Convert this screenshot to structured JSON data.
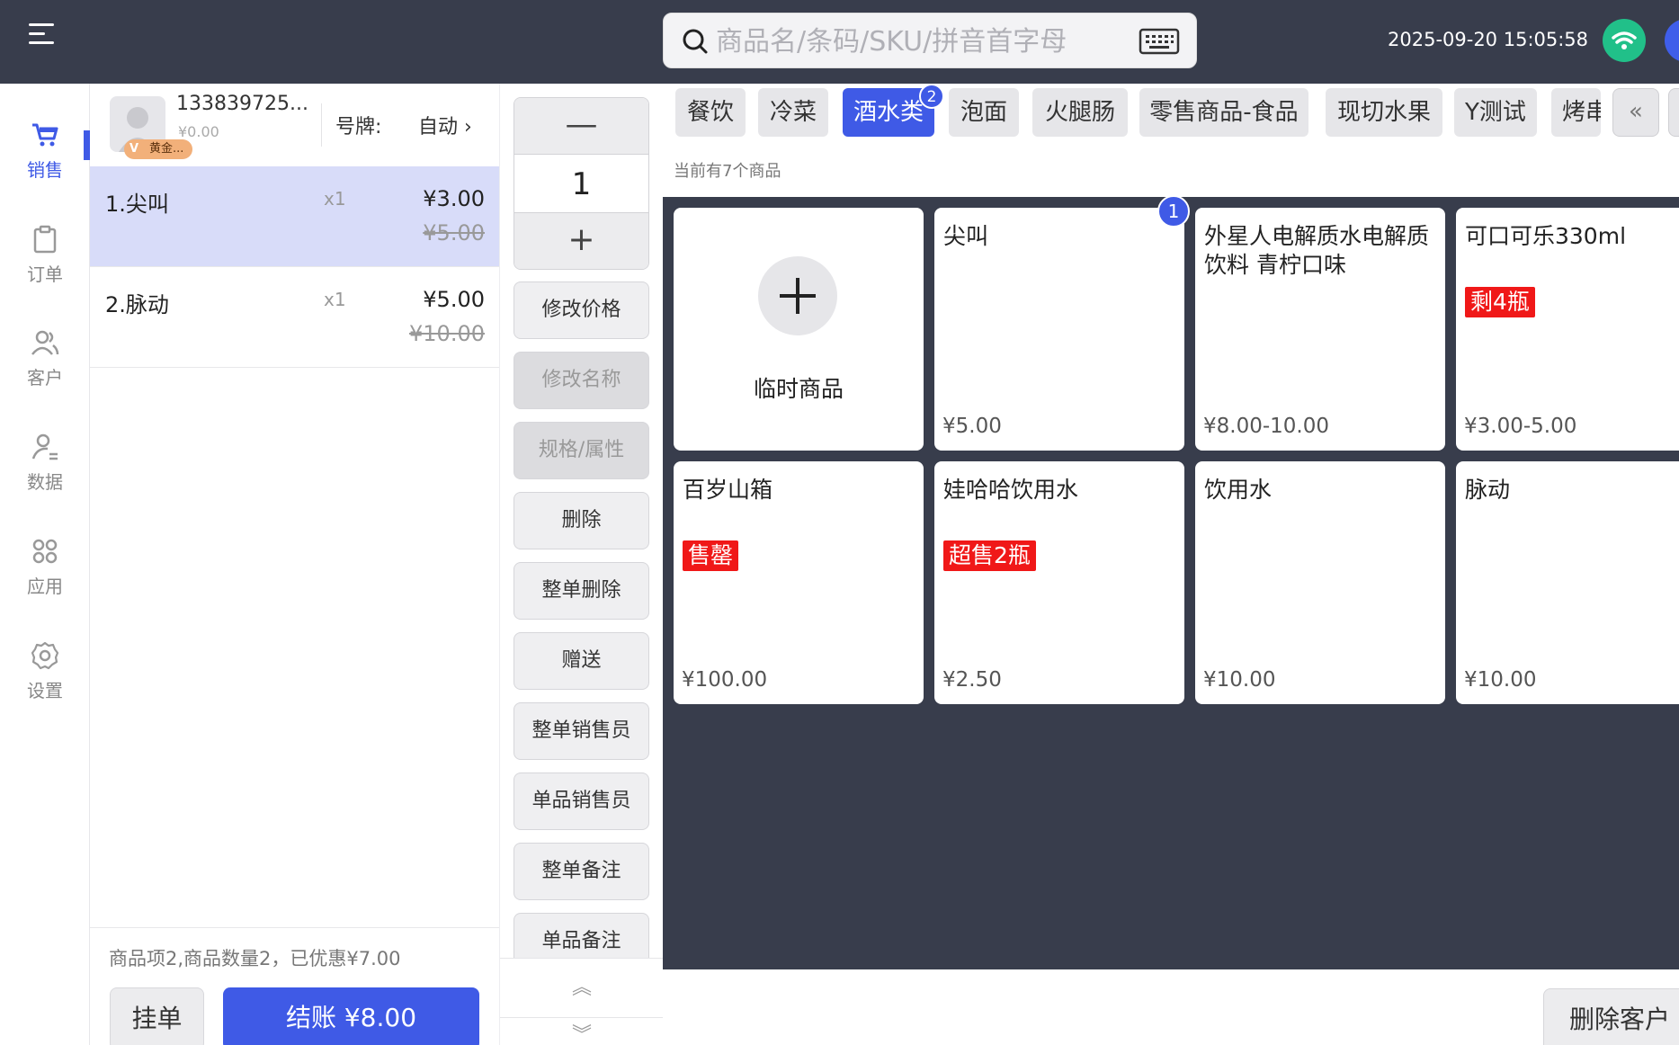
{
  "topbar": {
    "search_placeholder": "商品名/条码/SKU/拼音首字母",
    "datetime": "2025-09-20 15:05:58"
  },
  "nav": [
    {
      "label": "销售",
      "icon": "cart-icon",
      "active": true
    },
    {
      "label": "订单",
      "icon": "clipboard-icon"
    },
    {
      "label": "客户",
      "icon": "users-icon"
    },
    {
      "label": "数据",
      "icon": "user-data-icon"
    },
    {
      "label": "应用",
      "icon": "apps-icon"
    },
    {
      "label": "设置",
      "icon": "gear-icon"
    }
  ],
  "customer": {
    "id": "133839725...",
    "balance": "¥0.00",
    "vip": "黄金...",
    "plate_label": "号牌:",
    "plate_value": "自动 ›"
  },
  "order_items": [
    {
      "name": "1.尖叫",
      "qty": "x1",
      "price": "¥3.00",
      "orig": "¥5.00"
    },
    {
      "name": "2.脉动",
      "qty": "x1",
      "price": "¥5.00",
      "orig": "¥10.00"
    }
  ],
  "summary": {
    "text": "商品项2,商品数量2，已优惠¥7.00",
    "hold": "挂单",
    "pay": "结账 ¥8.00"
  },
  "actions": {
    "minus": "—",
    "qty": "1",
    "plus": "+",
    "buttons": [
      "修改价格",
      "修改名称",
      "规格/属性",
      "删除",
      "整单删除",
      "赠送",
      "整单销售员",
      "单品销售员",
      "整单备注",
      "单品备注"
    ],
    "scroll_up": "︽",
    "scroll_down": "︾"
  },
  "categories": [
    "餐饮",
    "冷菜",
    "酒水类",
    "泡面",
    "火腿肠",
    "零售商品-食品",
    "现切水果",
    "Y测试",
    "烤串"
  ],
  "category_badge": "2",
  "category_prev": "«",
  "product_count_text": "当前有7个商品",
  "temp_product": "临时商品",
  "products": [
    {
      "name": "尖叫",
      "price": "¥5.00",
      "tag": "",
      "badge": "1"
    },
    {
      "name": "外星人电解质水电解质饮料 青柠口味",
      "price": "¥8.00-10.00",
      "tag": ""
    },
    {
      "name": "可口可乐330ml",
      "price": "¥3.00-5.00",
      "tag": "剩4瓶"
    },
    {
      "name": "百岁山箱",
      "price": "¥100.00",
      "tag": "售罄"
    },
    {
      "name": "娃哈哈饮用水",
      "price": "¥2.50",
      "tag": "超售2瓶"
    },
    {
      "name": "饮用水",
      "price": "¥10.00",
      "tag": ""
    },
    {
      "name": "脉动",
      "price": "¥10.00",
      "tag": ""
    }
  ],
  "delete_customer": "删除客户",
  "colors": {
    "accent": "#3f5ae6",
    "topbar": "#383d4c",
    "tag_red": "#f01818",
    "wifi_green": "#21c089"
  }
}
